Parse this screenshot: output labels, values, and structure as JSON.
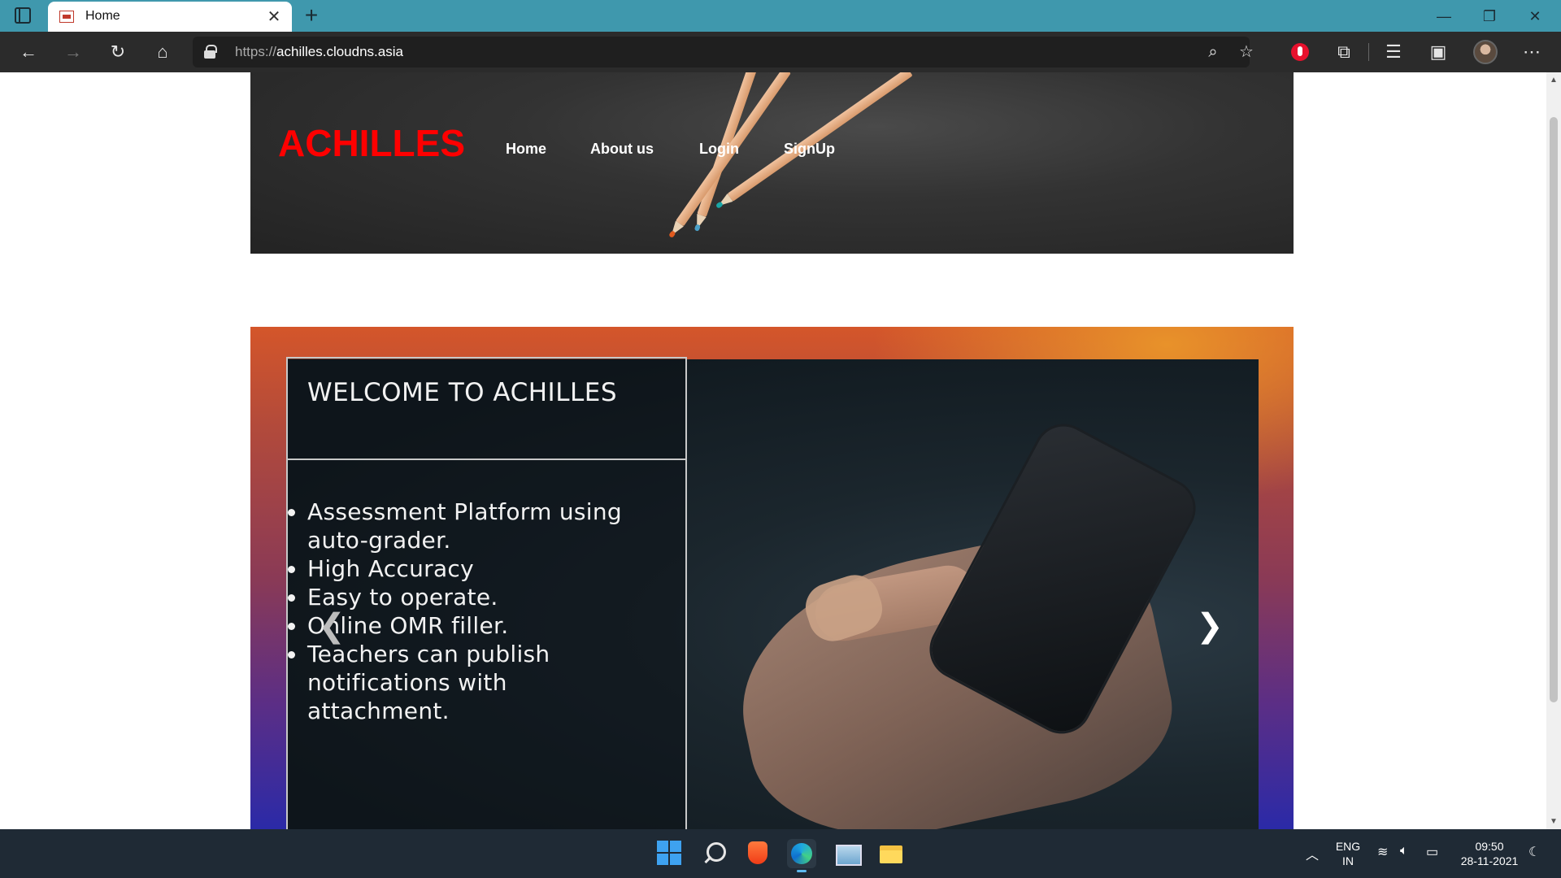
{
  "browser": {
    "tab_title": "Home",
    "url_scheme": "https://",
    "url_host": "achilles.cloudns.asia",
    "icons": [
      "tab-actions-icon",
      "close-icon",
      "new-tab-icon",
      "minimize-icon",
      "restore-icon",
      "window-close-icon",
      "back-icon",
      "forward-icon",
      "refresh-icon",
      "home-icon",
      "lock-icon",
      "zoom-icon",
      "add-favorite-icon",
      "extensions-icon",
      "favorites-icon",
      "collections-icon",
      "profile-avatar",
      "more-icon"
    ]
  },
  "site": {
    "brand": "ACHILLES",
    "brand_color": "#ff0000",
    "nav": [
      "Home",
      "About us",
      "Login",
      "SignUp"
    ]
  },
  "hero": {
    "title": "WELCOME TO ACHILLES",
    "features": [
      "Assessment Platform using auto-grader.",
      "High Accuracy",
      "Easy to operate.",
      "Online OMR filler.",
      "Teachers can publish notifications with attachment."
    ],
    "prev_icon": "chevron-left-icon",
    "next_icon": "chevron-right-icon"
  },
  "taskbar": {
    "apps": [
      "start-icon",
      "search-icon",
      "brave-icon",
      "edge-icon",
      "photos-icon",
      "file-explorer-icon"
    ],
    "language": "ENG",
    "region": "IN",
    "time": "09:50",
    "date": "28-11-2021"
  }
}
